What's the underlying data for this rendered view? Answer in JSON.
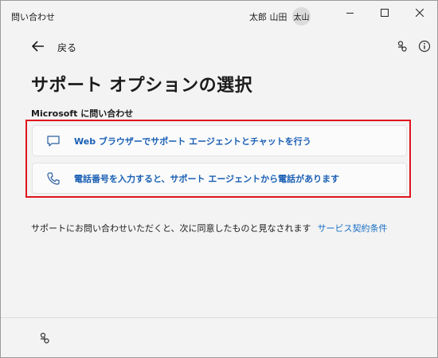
{
  "window": {
    "title": "問い合わせ",
    "user_name": "太郎 山田",
    "avatar_text": "太山"
  },
  "nav": {
    "back_label": "戻る"
  },
  "page": {
    "title": "サポート オプションの選択",
    "section_label": "Microsoft に問い合わせ"
  },
  "options": [
    {
      "label": "Web ブラウザーでサポート エージェントとチャットを行う",
      "icon": "chat-icon"
    },
    {
      "label": "電話番号を入力すると、サポート エージェントから電話があります",
      "icon": "phone-icon"
    }
  ],
  "consent": {
    "text": "サポートにお問い合わせいただくと、次に同意したものと見なされます",
    "link": "サービス契約条件"
  },
  "colors": {
    "accent": "#1a5fb4",
    "highlight": "#e0141e",
    "background": "#f3f3f3"
  }
}
